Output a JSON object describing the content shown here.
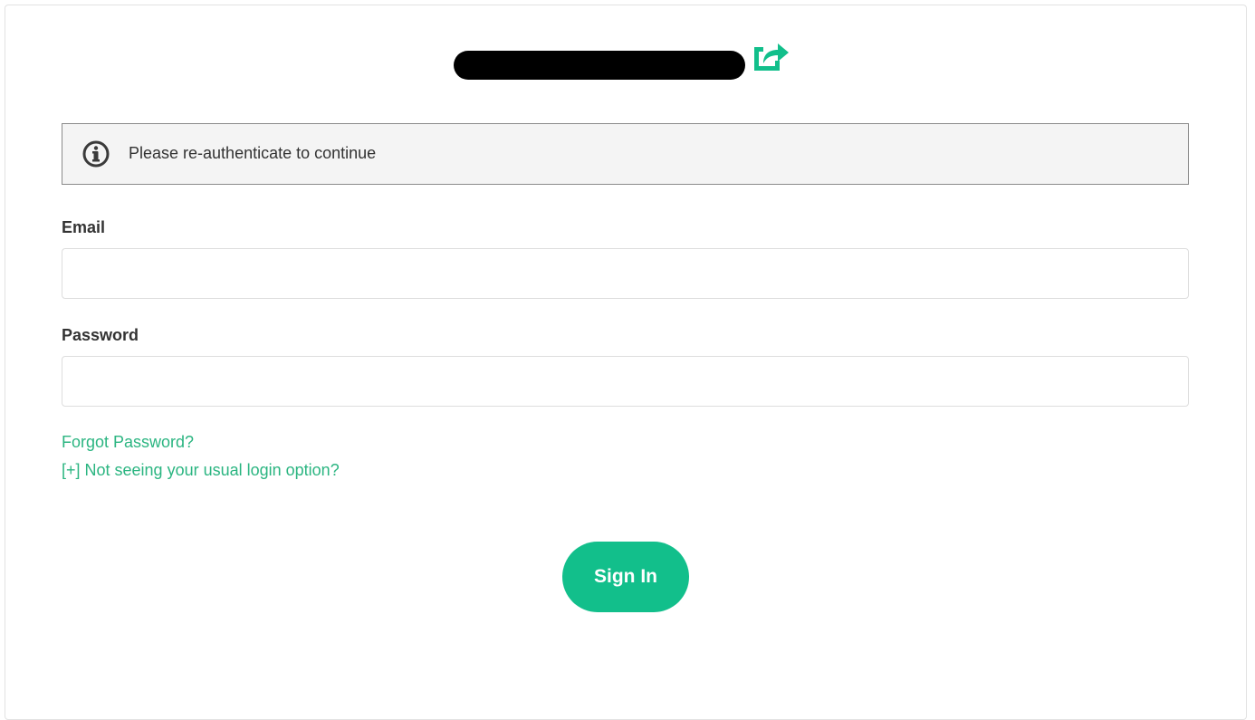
{
  "alert": {
    "icon": "info-icon",
    "text": "Please re-authenticate to continue"
  },
  "header": {
    "external_icon": "external-link-icon",
    "accent_color": "#12bf8b"
  },
  "form": {
    "email_label": "Email",
    "email_value": "",
    "password_label": "Password",
    "password_value": "",
    "forgot_password_link": "Forgot Password?",
    "other_login_link": "[+] Not seeing your usual login option?",
    "sign_in_label": "Sign In"
  }
}
